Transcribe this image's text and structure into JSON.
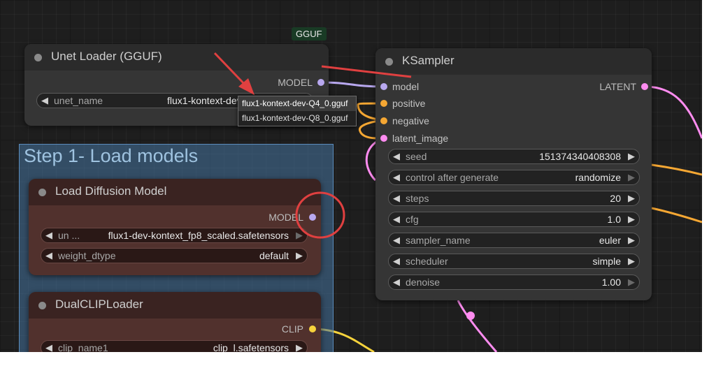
{
  "canvas": {
    "badge": "GGUF"
  },
  "unet_loader": {
    "title": "Unet Loader (GGUF)",
    "output": "MODEL",
    "widget": {
      "label": "unet_name",
      "value": "flux1-kontext-dev-"
    },
    "dropdown_options": [
      "flux1-kontext-dev-Q4_0.gguf",
      "flux1-kontext-dev-Q8_0.gguf"
    ]
  },
  "group": {
    "title": "Step 1- Load models"
  },
  "load_diffusion": {
    "title": "Load Diffusion Model",
    "output": "MODEL",
    "widgets": [
      {
        "label": "un ...",
        "value": "flux1-dev-kontext_fp8_scaled.safetensors"
      },
      {
        "label": "weight_dtype",
        "value": "default"
      }
    ]
  },
  "dual_clip": {
    "title": "DualCLIPLoader",
    "output": "CLIP",
    "widgets": [
      {
        "label": "clip_name1",
        "value": "clip_l.safetensors"
      }
    ]
  },
  "ksampler": {
    "title": "KSampler",
    "inputs": [
      "model",
      "positive",
      "negative",
      "latent_image"
    ],
    "output": "LATENT",
    "widgets": [
      {
        "label": "seed",
        "value": "151374340408308"
      },
      {
        "label": "control after generate",
        "value": "randomize"
      },
      {
        "label": "steps",
        "value": "20"
      },
      {
        "label": "cfg",
        "value": "1.0"
      },
      {
        "label": "sampler_name",
        "value": "euler"
      },
      {
        "label": "scheduler",
        "value": "simple"
      },
      {
        "label": "denoise",
        "value": "1.00"
      }
    ]
  },
  "glyphs": {
    "left": "◀",
    "right": "▶"
  },
  "colors": {
    "model_slot": "#b8a8ef",
    "conditioning_slot": "#f5a733",
    "latent_slot": "#ff8cf0",
    "clip_slot": "#f7d33c",
    "annotation": "#e04040"
  }
}
